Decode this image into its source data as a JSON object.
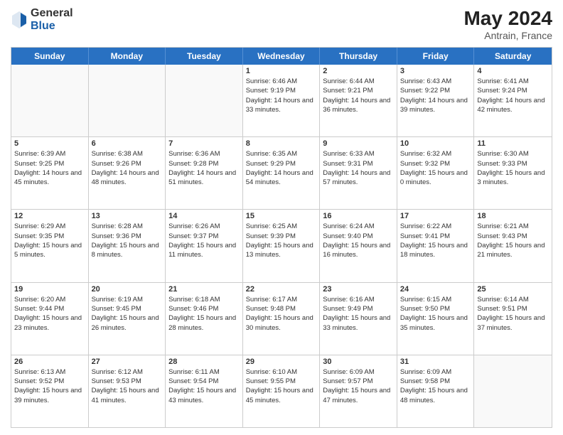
{
  "header": {
    "logo_general": "General",
    "logo_blue": "Blue",
    "month_year": "May 2024",
    "location": "Antrain, France"
  },
  "days_of_week": [
    "Sunday",
    "Monday",
    "Tuesday",
    "Wednesday",
    "Thursday",
    "Friday",
    "Saturday"
  ],
  "rows": [
    [
      {
        "day": "",
        "empty": true
      },
      {
        "day": "",
        "empty": true
      },
      {
        "day": "",
        "empty": true
      },
      {
        "day": "1",
        "sunrise": "6:46 AM",
        "sunset": "9:19 PM",
        "daylight": "14 hours and 33 minutes."
      },
      {
        "day": "2",
        "sunrise": "6:44 AM",
        "sunset": "9:21 PM",
        "daylight": "14 hours and 36 minutes."
      },
      {
        "day": "3",
        "sunrise": "6:43 AM",
        "sunset": "9:22 PM",
        "daylight": "14 hours and 39 minutes."
      },
      {
        "day": "4",
        "sunrise": "6:41 AM",
        "sunset": "9:24 PM",
        "daylight": "14 hours and 42 minutes."
      }
    ],
    [
      {
        "day": "5",
        "sunrise": "6:39 AM",
        "sunset": "9:25 PM",
        "daylight": "14 hours and 45 minutes."
      },
      {
        "day": "6",
        "sunrise": "6:38 AM",
        "sunset": "9:26 PM",
        "daylight": "14 hours and 48 minutes."
      },
      {
        "day": "7",
        "sunrise": "6:36 AM",
        "sunset": "9:28 PM",
        "daylight": "14 hours and 51 minutes."
      },
      {
        "day": "8",
        "sunrise": "6:35 AM",
        "sunset": "9:29 PM",
        "daylight": "14 hours and 54 minutes."
      },
      {
        "day": "9",
        "sunrise": "6:33 AM",
        "sunset": "9:31 PM",
        "daylight": "14 hours and 57 minutes."
      },
      {
        "day": "10",
        "sunrise": "6:32 AM",
        "sunset": "9:32 PM",
        "daylight": "15 hours and 0 minutes."
      },
      {
        "day": "11",
        "sunrise": "6:30 AM",
        "sunset": "9:33 PM",
        "daylight": "15 hours and 3 minutes."
      }
    ],
    [
      {
        "day": "12",
        "sunrise": "6:29 AM",
        "sunset": "9:35 PM",
        "daylight": "15 hours and 5 minutes."
      },
      {
        "day": "13",
        "sunrise": "6:28 AM",
        "sunset": "9:36 PM",
        "daylight": "15 hours and 8 minutes."
      },
      {
        "day": "14",
        "sunrise": "6:26 AM",
        "sunset": "9:37 PM",
        "daylight": "15 hours and 11 minutes."
      },
      {
        "day": "15",
        "sunrise": "6:25 AM",
        "sunset": "9:39 PM",
        "daylight": "15 hours and 13 minutes."
      },
      {
        "day": "16",
        "sunrise": "6:24 AM",
        "sunset": "9:40 PM",
        "daylight": "15 hours and 16 minutes."
      },
      {
        "day": "17",
        "sunrise": "6:22 AM",
        "sunset": "9:41 PM",
        "daylight": "15 hours and 18 minutes."
      },
      {
        "day": "18",
        "sunrise": "6:21 AM",
        "sunset": "9:43 PM",
        "daylight": "15 hours and 21 minutes."
      }
    ],
    [
      {
        "day": "19",
        "sunrise": "6:20 AM",
        "sunset": "9:44 PM",
        "daylight": "15 hours and 23 minutes."
      },
      {
        "day": "20",
        "sunrise": "6:19 AM",
        "sunset": "9:45 PM",
        "daylight": "15 hours and 26 minutes."
      },
      {
        "day": "21",
        "sunrise": "6:18 AM",
        "sunset": "9:46 PM",
        "daylight": "15 hours and 28 minutes."
      },
      {
        "day": "22",
        "sunrise": "6:17 AM",
        "sunset": "9:48 PM",
        "daylight": "15 hours and 30 minutes."
      },
      {
        "day": "23",
        "sunrise": "6:16 AM",
        "sunset": "9:49 PM",
        "daylight": "15 hours and 33 minutes."
      },
      {
        "day": "24",
        "sunrise": "6:15 AM",
        "sunset": "9:50 PM",
        "daylight": "15 hours and 35 minutes."
      },
      {
        "day": "25",
        "sunrise": "6:14 AM",
        "sunset": "9:51 PM",
        "daylight": "15 hours and 37 minutes."
      }
    ],
    [
      {
        "day": "26",
        "sunrise": "6:13 AM",
        "sunset": "9:52 PM",
        "daylight": "15 hours and 39 minutes."
      },
      {
        "day": "27",
        "sunrise": "6:12 AM",
        "sunset": "9:53 PM",
        "daylight": "15 hours and 41 minutes."
      },
      {
        "day": "28",
        "sunrise": "6:11 AM",
        "sunset": "9:54 PM",
        "daylight": "15 hours and 43 minutes."
      },
      {
        "day": "29",
        "sunrise": "6:10 AM",
        "sunset": "9:55 PM",
        "daylight": "15 hours and 45 minutes."
      },
      {
        "day": "30",
        "sunrise": "6:09 AM",
        "sunset": "9:57 PM",
        "daylight": "15 hours and 47 minutes."
      },
      {
        "day": "31",
        "sunrise": "6:09 AM",
        "sunset": "9:58 PM",
        "daylight": "15 hours and 48 minutes."
      },
      {
        "day": "",
        "empty": true
      }
    ]
  ]
}
